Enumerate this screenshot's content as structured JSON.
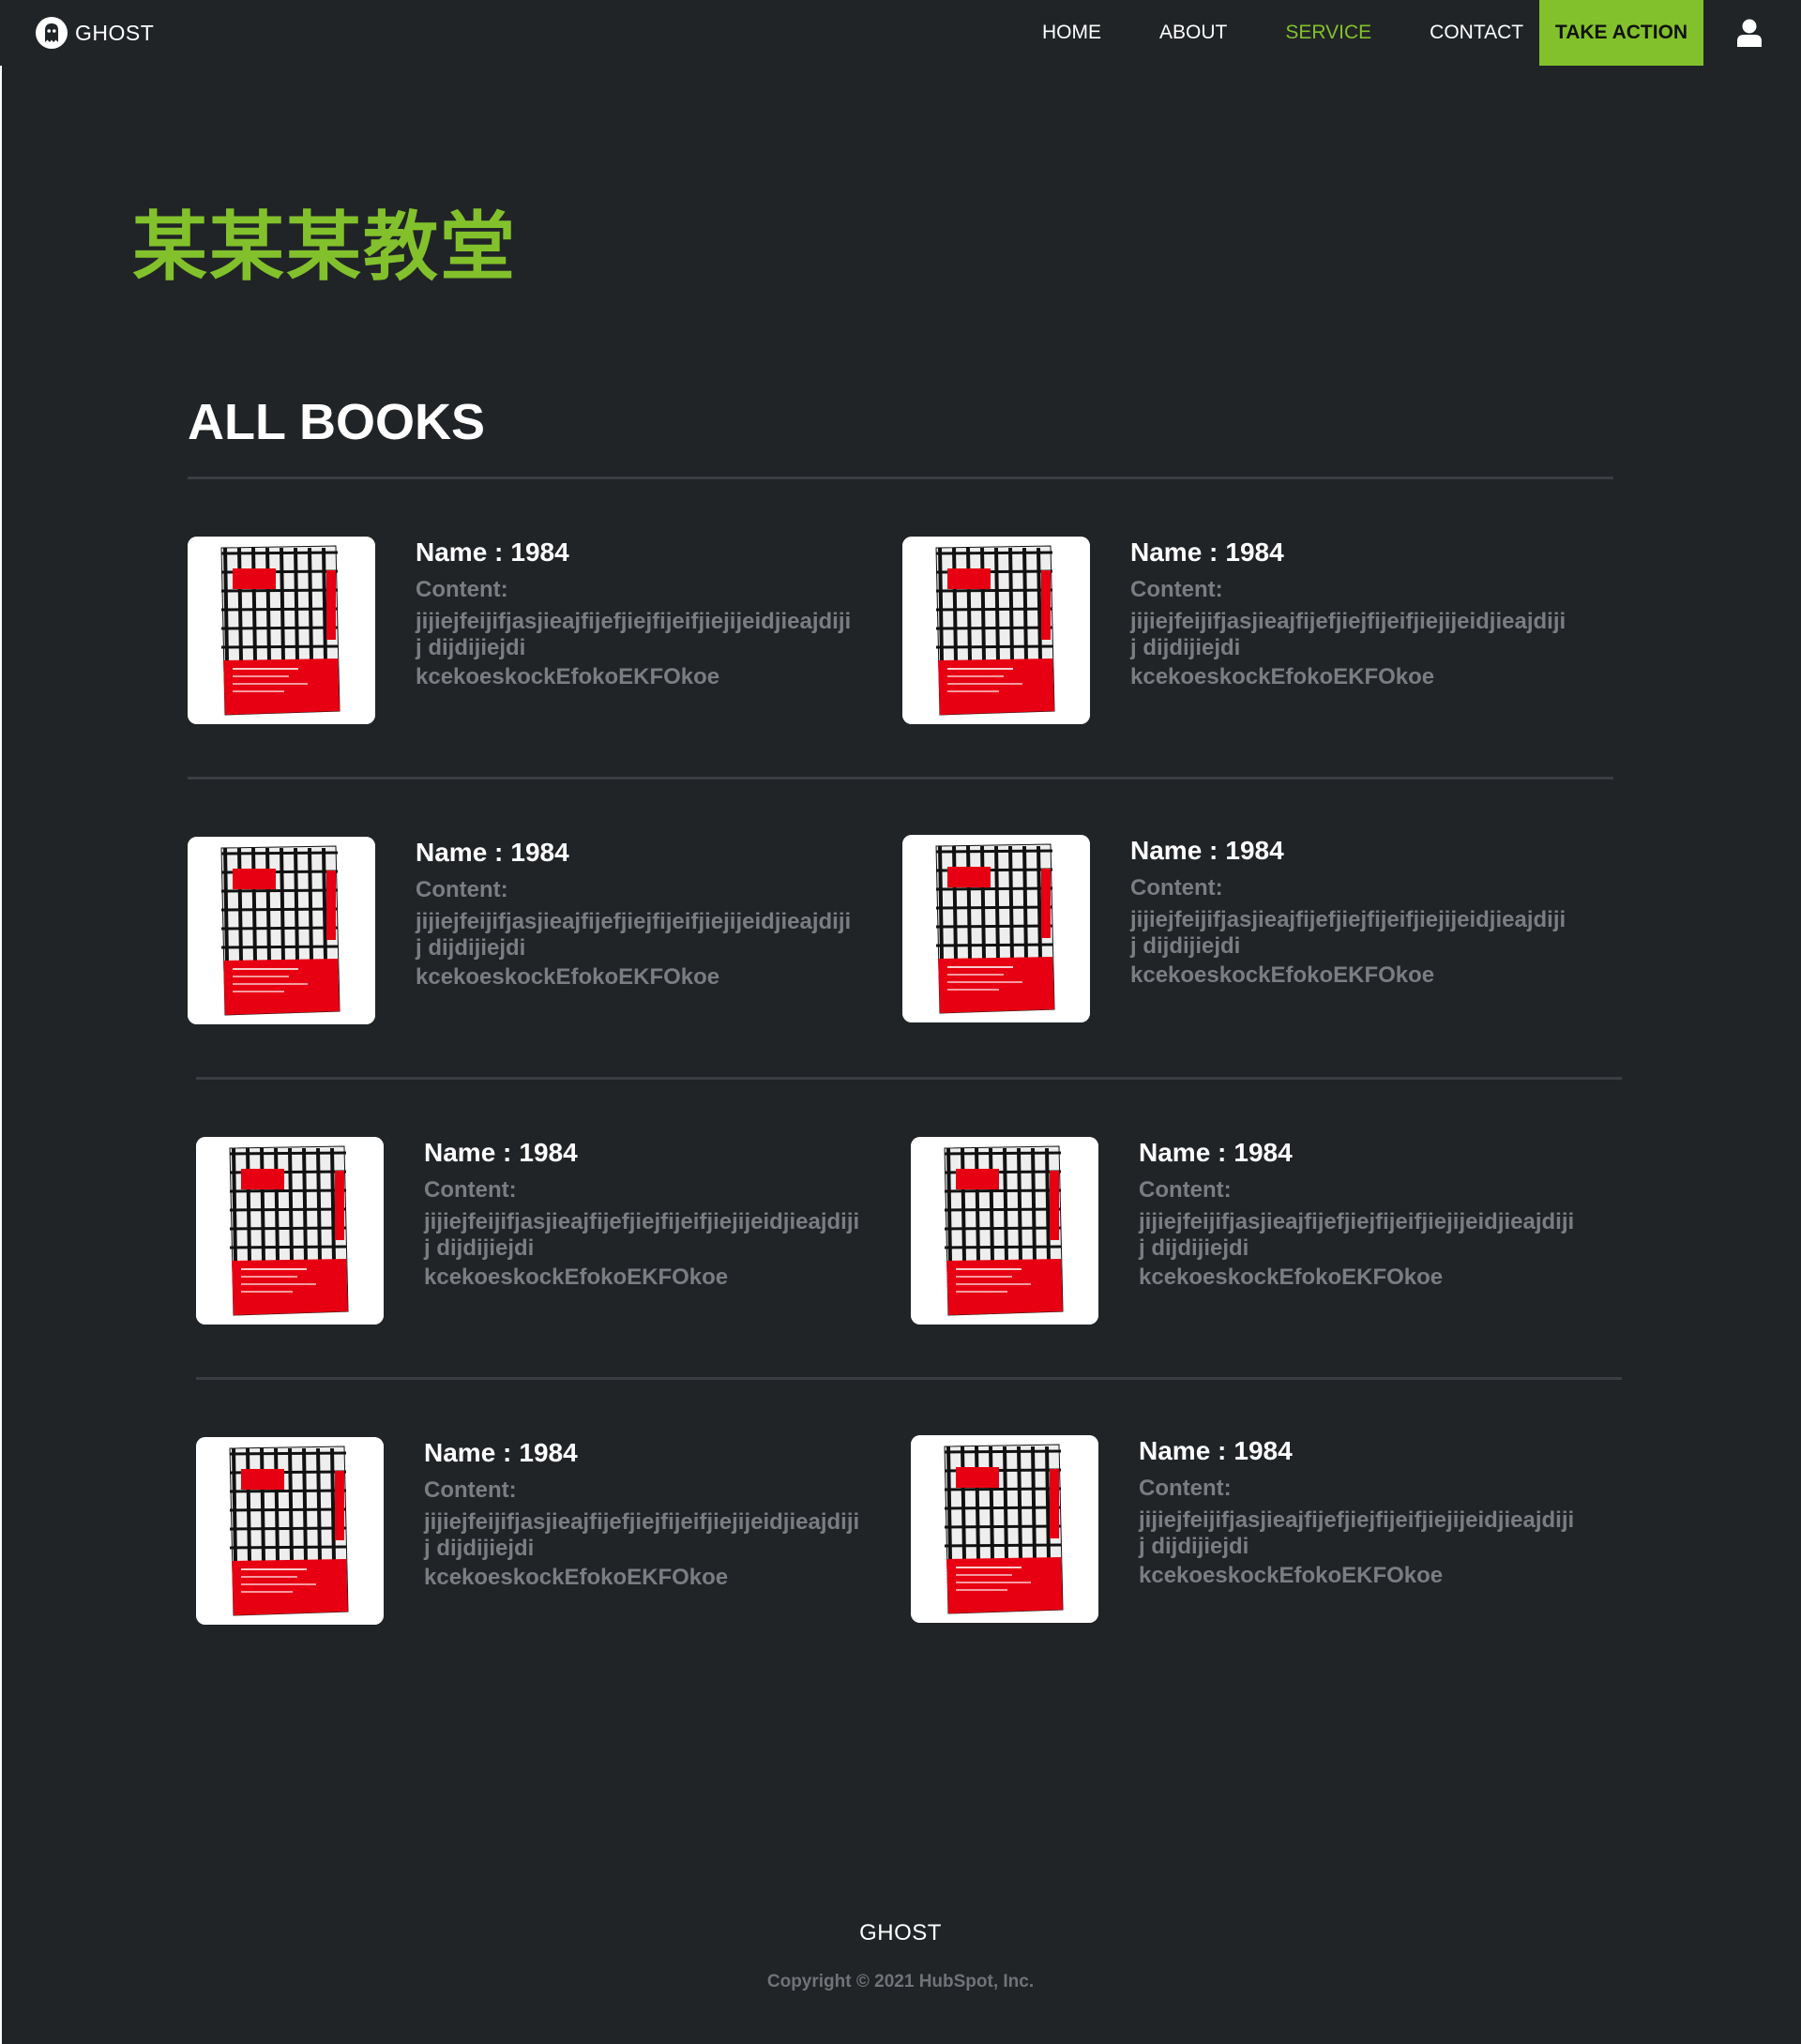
{
  "nav": {
    "brand": "GHOST",
    "links": [
      {
        "label": "HOME"
      },
      {
        "label": "ABOUT"
      },
      {
        "label": "SERVICE"
      },
      {
        "label": "CONTACT"
      }
    ],
    "active_link": "SERVICE",
    "cta": "TAKE ACTION",
    "user_icon": "user-icon"
  },
  "hero": {
    "title": "某某某教堂"
  },
  "books_section": {
    "title": "ALL BOOKS",
    "name_label": "Name :",
    "content_label": "Content:",
    "books": [
      {
        "name": "1984",
        "content_line1": "jijiejfeijifjasjieajfijefjiejfijeifjiejijeidjieajdijij dijdijiejdi",
        "content_line2": "kcekoeskockEfokoEKFOkoe"
      },
      {
        "name": "1984",
        "content_line1": "jijiejfeijifjasjieajfijefjiejfijeifjiejijeidjieajdijij dijdijiejdi",
        "content_line2": "kcekoeskockEfokoEKFOkoe"
      },
      {
        "name": "1984",
        "content_line1": "jijiejfeijifjasjieajfijefjiejfijeifjiejijeidjieajdijij dijdijiejdi",
        "content_line2": "kcekoeskockEfokoEKFOkoe"
      },
      {
        "name": "1984",
        "content_line1": "jijiejfeijifjasjieajfijefjiejfijeifjiejijeidjieajdijij dijdijiejdi",
        "content_line2": "kcekoeskockEfokoEKFOkoe"
      },
      {
        "name": "1984",
        "content_line1": "jijiejfeijifjasjieajfijefjiejfijeifjiejijeidjieajdijij dijdijiejdi",
        "content_line2": "kcekoeskockEfokoEKFOkoe"
      },
      {
        "name": "1984",
        "content_line1": "jijiejfeijifjasjieajfijefjiejfijeifjiejijeidjieajdijij dijdijiejdi",
        "content_line2": "kcekoeskockEfokoEKFOkoe"
      },
      {
        "name": "1984",
        "content_line1": "jijiejfeijifjasjieajfijefjiejfijeifjiejijeidjieajdijij dijdijiejdi",
        "content_line2": "kcekoeskockEfokoEKFOkoe"
      },
      {
        "name": "1984",
        "content_line1": "jijiejfeijifjasjieajfijefjiejfijeifjiejijeidjieajdijij dijdijiejdi",
        "content_line2": "kcekoeskockEfokoEKFOkoe"
      }
    ]
  },
  "footer": {
    "brand": "GHOST",
    "copyright": "Copyright © 2021 HubSpot, Inc."
  },
  "colors": {
    "background": "#212427",
    "accent": "#82c12b",
    "muted_text": "#7a7d81",
    "divider": "#3a3d41"
  }
}
